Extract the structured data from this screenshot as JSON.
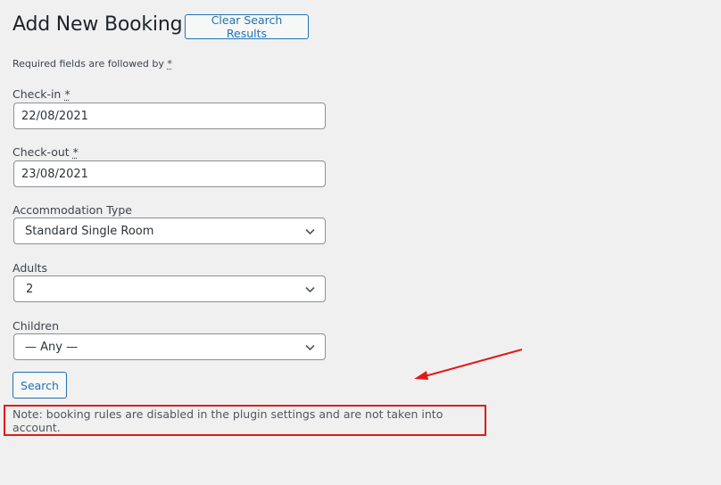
{
  "header": {
    "title": "Add New Booking",
    "clear_button_label": "Clear Search Results"
  },
  "form": {
    "required_note_text": "Required fields are followed by",
    "required_marker": "*",
    "checkin": {
      "label": "Check-in",
      "value": "22/08/2021"
    },
    "checkout": {
      "label": "Check-out",
      "value": "23/08/2021"
    },
    "accommodation_type": {
      "label": "Accommodation Type",
      "selected": "Standard Single Room"
    },
    "adults": {
      "label": "Adults",
      "selected": "2"
    },
    "children": {
      "label": "Children",
      "selected": "— Any —"
    },
    "search_button_label": "Search"
  },
  "notice": {
    "text": "Note: booking rules are disabled in the plugin settings and are not taken into account.",
    "highlight_color": "#e01b1b"
  },
  "annotation": {
    "arrow_color": "#e01b1b"
  }
}
